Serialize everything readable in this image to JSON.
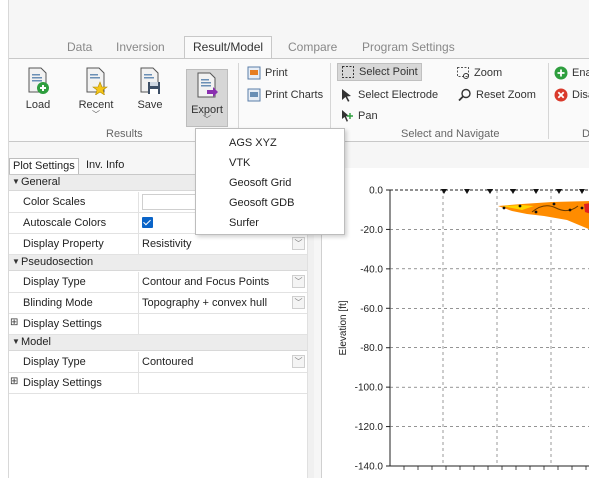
{
  "tabs": [
    {
      "label": "Data",
      "active": false
    },
    {
      "label": "Inversion",
      "active": false
    },
    {
      "label": "Result/Model",
      "active": true
    },
    {
      "label": "Compare",
      "active": false
    },
    {
      "label": "Program Settings",
      "active": false
    }
  ],
  "ribbon": {
    "results": {
      "load": "Load",
      "recent": "Recent",
      "save": "Save",
      "export": "Export",
      "group_label": "Results"
    },
    "print": {
      "print": "Print",
      "print_charts": "Print Charts"
    },
    "select_navigate": {
      "select_point": "Select Point",
      "zoom": "Zoom",
      "select_electrode": "Select Electrode",
      "reset_zoom": "Reset Zoom",
      "pan": "Pan",
      "group_label": "Select and Navigate"
    },
    "right": {
      "enable": "Ena",
      "disable": "Disa",
      "group_label": "D"
    }
  },
  "export_menu": [
    "AGS XYZ",
    "VTK",
    "Geosoft Grid",
    "Geosoft GDB",
    "Surfer"
  ],
  "panel": {
    "tabs": [
      "Plot Settings",
      "Inv. Info"
    ],
    "rows": [
      {
        "type": "section",
        "label": "General"
      },
      {
        "type": "prop",
        "label": "Color Scales",
        "value": "",
        "control": "field"
      },
      {
        "type": "prop",
        "label": "Autoscale Colors",
        "value": "",
        "control": "checkbox"
      },
      {
        "type": "prop",
        "label": "Display Property",
        "value": "Resistivity",
        "control": "dropdown"
      },
      {
        "type": "section",
        "label": "Pseudosection"
      },
      {
        "type": "prop",
        "label": "Display Type",
        "value": "Contour and Focus Points",
        "control": "dropdown"
      },
      {
        "type": "prop",
        "label": "Blinding Mode",
        "value": "Topography + convex hull",
        "control": "dropdown"
      },
      {
        "type": "collapsed",
        "label": "Display Settings"
      },
      {
        "type": "section",
        "label": "Model"
      },
      {
        "type": "prop",
        "label": "Display Type",
        "value": "Contoured",
        "control": "dropdown"
      },
      {
        "type": "collapsed",
        "label": "Display Settings"
      }
    ]
  },
  "chart_data": {
    "type": "area",
    "ylabel": "Elevation [ft]",
    "ylim": [
      -140,
      0
    ],
    "y_ticks": [
      "0.0",
      "-20.0",
      "-40.0",
      "-60.0",
      "-80.0",
      "-100.0",
      "-120.0",
      "-140.0"
    ],
    "grid": true,
    "electrode_marker_count": 7,
    "colors": {
      "orange": "#ff8c00",
      "yellow": "#ffd400",
      "red": "#e02020"
    }
  },
  "colors": {
    "accent_green": "#2e9e3e",
    "accent_red": "#d93a2b",
    "menu_bg": "#ffffff",
    "check_blue": "#0a64c8"
  }
}
